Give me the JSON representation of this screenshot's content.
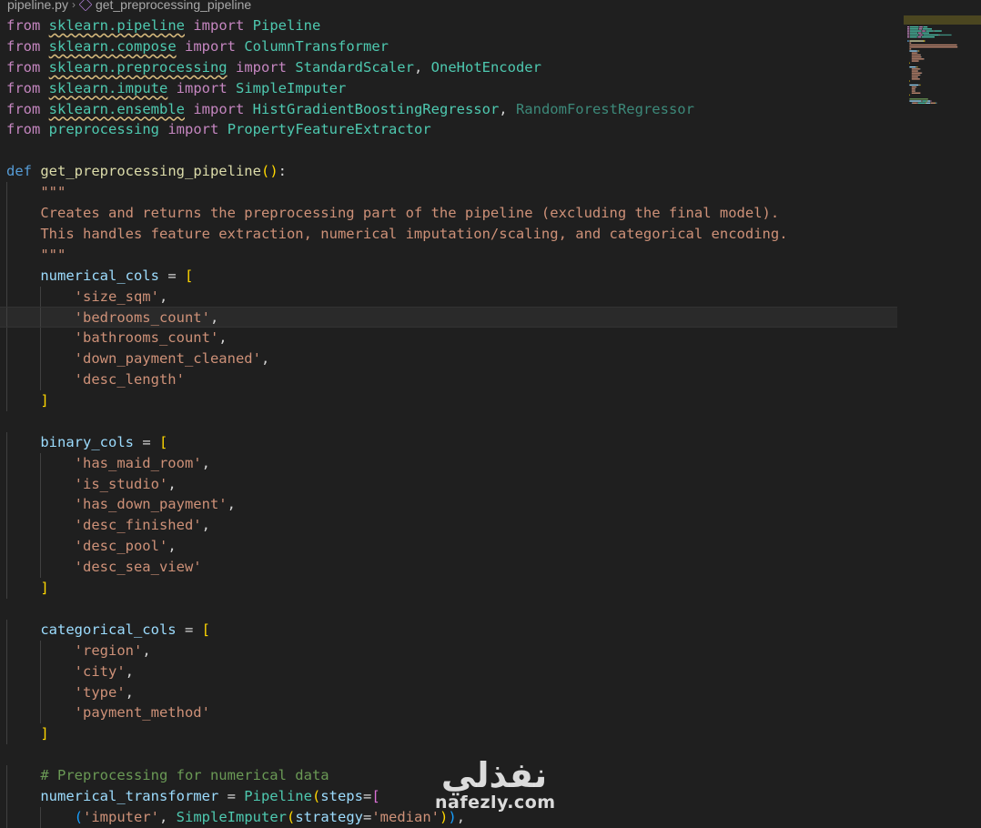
{
  "breadcrumb": {
    "file": "pipeline.py",
    "symbol": "get_preprocessing_pipeline"
  },
  "watermark": {
    "arabic": "نفذلي",
    "latin": "nafezly.com"
  },
  "code": {
    "lines": [
      {
        "tokens": [
          {
            "t": "kw",
            "v": "from"
          },
          {
            "t": "txt",
            "v": " "
          },
          {
            "t": "mod",
            "v": "sklearn.pipeline"
          },
          {
            "t": "txt",
            "v": " "
          },
          {
            "t": "kw",
            "v": "import"
          },
          {
            "t": "txt",
            "v": " "
          },
          {
            "t": "cls",
            "v": "Pipeline"
          }
        ]
      },
      {
        "tokens": [
          {
            "t": "kw",
            "v": "from"
          },
          {
            "t": "txt",
            "v": " "
          },
          {
            "t": "mod",
            "v": "sklearn.compose"
          },
          {
            "t": "txt",
            "v": " "
          },
          {
            "t": "kw",
            "v": "import"
          },
          {
            "t": "txt",
            "v": " "
          },
          {
            "t": "cls",
            "v": "ColumnTransformer"
          }
        ]
      },
      {
        "tokens": [
          {
            "t": "kw",
            "v": "from"
          },
          {
            "t": "txt",
            "v": " "
          },
          {
            "t": "mod",
            "v": "sklearn.preprocessing"
          },
          {
            "t": "txt",
            "v": " "
          },
          {
            "t": "kw",
            "v": "import"
          },
          {
            "t": "txt",
            "v": " "
          },
          {
            "t": "cls",
            "v": "StandardScaler"
          },
          {
            "t": "txt",
            "v": ", "
          },
          {
            "t": "cls",
            "v": "OneHotEncoder"
          }
        ]
      },
      {
        "tokens": [
          {
            "t": "kw",
            "v": "from"
          },
          {
            "t": "txt",
            "v": " "
          },
          {
            "t": "mod",
            "v": "sklearn.impute"
          },
          {
            "t": "txt",
            "v": " "
          },
          {
            "t": "kw",
            "v": "import"
          },
          {
            "t": "txt",
            "v": " "
          },
          {
            "t": "cls",
            "v": "SimpleImputer"
          }
        ]
      },
      {
        "tokens": [
          {
            "t": "kw",
            "v": "from"
          },
          {
            "t": "txt",
            "v": " "
          },
          {
            "t": "mod",
            "v": "sklearn.ensemble"
          },
          {
            "t": "txt",
            "v": " "
          },
          {
            "t": "kw",
            "v": "import"
          },
          {
            "t": "txt",
            "v": " "
          },
          {
            "t": "cls",
            "v": "HistGradientBoostingRegressor"
          },
          {
            "t": "txt",
            "v": ", "
          },
          {
            "t": "dim",
            "v": "RandomForestRegressor"
          }
        ]
      },
      {
        "tokens": [
          {
            "t": "kw",
            "v": "from"
          },
          {
            "t": "txt",
            "v": " "
          },
          {
            "t": "mod2",
            "v": "preprocessing"
          },
          {
            "t": "txt",
            "v": " "
          },
          {
            "t": "kw",
            "v": "import"
          },
          {
            "t": "txt",
            "v": " "
          },
          {
            "t": "cls",
            "v": "PropertyFeatureExtractor"
          }
        ]
      },
      {
        "tokens": []
      },
      {
        "tokens": [
          {
            "t": "def",
            "v": "def"
          },
          {
            "t": "txt",
            "v": " "
          },
          {
            "t": "fn",
            "v": "get_preprocessing_pipeline"
          },
          {
            "t": "br1",
            "v": "()"
          },
          {
            "t": "txt",
            "v": ":"
          }
        ]
      },
      {
        "indent": 1,
        "tokens": [
          {
            "t": "str",
            "v": "\"\"\""
          }
        ]
      },
      {
        "indent": 1,
        "tokens": [
          {
            "t": "str",
            "v": "Creates and returns the preprocessing part of the pipeline (excluding the final model)."
          }
        ]
      },
      {
        "indent": 1,
        "tokens": [
          {
            "t": "str",
            "v": "This handles feature extraction, numerical imputation/scaling, and categorical encoding."
          }
        ]
      },
      {
        "indent": 1,
        "tokens": [
          {
            "t": "str",
            "v": "\"\"\""
          }
        ]
      },
      {
        "indent": 1,
        "tokens": [
          {
            "t": "var",
            "v": "numerical_cols"
          },
          {
            "t": "txt",
            "v": " = "
          },
          {
            "t": "br1",
            "v": "["
          }
        ]
      },
      {
        "indent": 2,
        "tokens": [
          {
            "t": "str",
            "v": "'size_sqm'"
          },
          {
            "t": "txt",
            "v": ","
          }
        ]
      },
      {
        "indent": 2,
        "hl": true,
        "tokens": [
          {
            "t": "str",
            "v": "'bedrooms_count'"
          },
          {
            "t": "txt",
            "v": ","
          }
        ]
      },
      {
        "indent": 2,
        "tokens": [
          {
            "t": "str",
            "v": "'bathrooms_count'"
          },
          {
            "t": "txt",
            "v": ","
          }
        ]
      },
      {
        "indent": 2,
        "tokens": [
          {
            "t": "str",
            "v": "'down_payment_cleaned'"
          },
          {
            "t": "txt",
            "v": ","
          }
        ]
      },
      {
        "indent": 2,
        "tokens": [
          {
            "t": "str",
            "v": "'desc_length'"
          }
        ]
      },
      {
        "indent": 1,
        "tokens": [
          {
            "t": "br1",
            "v": "]"
          }
        ]
      },
      {
        "tokens": []
      },
      {
        "indent": 1,
        "tokens": [
          {
            "t": "var",
            "v": "binary_cols"
          },
          {
            "t": "txt",
            "v": " = "
          },
          {
            "t": "br1",
            "v": "["
          }
        ]
      },
      {
        "indent": 2,
        "tokens": [
          {
            "t": "str",
            "v": "'has_maid_room'"
          },
          {
            "t": "txt",
            "v": ","
          }
        ]
      },
      {
        "indent": 2,
        "tokens": [
          {
            "t": "str",
            "v": "'is_studio'"
          },
          {
            "t": "txt",
            "v": ","
          }
        ]
      },
      {
        "indent": 2,
        "tokens": [
          {
            "t": "str",
            "v": "'has_down_payment'"
          },
          {
            "t": "txt",
            "v": ","
          }
        ]
      },
      {
        "indent": 2,
        "tokens": [
          {
            "t": "str",
            "v": "'desc_finished'"
          },
          {
            "t": "txt",
            "v": ","
          }
        ]
      },
      {
        "indent": 2,
        "tokens": [
          {
            "t": "str",
            "v": "'desc_pool'"
          },
          {
            "t": "txt",
            "v": ","
          }
        ]
      },
      {
        "indent": 2,
        "tokens": [
          {
            "t": "str",
            "v": "'desc_sea_view'"
          }
        ]
      },
      {
        "indent": 1,
        "tokens": [
          {
            "t": "br1",
            "v": "]"
          }
        ]
      },
      {
        "tokens": []
      },
      {
        "indent": 1,
        "tokens": [
          {
            "t": "var",
            "v": "categorical_cols"
          },
          {
            "t": "txt",
            "v": " = "
          },
          {
            "t": "br1",
            "v": "["
          }
        ]
      },
      {
        "indent": 2,
        "tokens": [
          {
            "t": "str",
            "v": "'region'"
          },
          {
            "t": "txt",
            "v": ","
          }
        ]
      },
      {
        "indent": 2,
        "tokens": [
          {
            "t": "str",
            "v": "'city'"
          },
          {
            "t": "txt",
            "v": ","
          }
        ]
      },
      {
        "indent": 2,
        "tokens": [
          {
            "t": "str",
            "v": "'type'"
          },
          {
            "t": "txt",
            "v": ","
          }
        ]
      },
      {
        "indent": 2,
        "tokens": [
          {
            "t": "str",
            "v": "'payment_method'"
          }
        ]
      },
      {
        "indent": 1,
        "tokens": [
          {
            "t": "br1",
            "v": "]"
          }
        ]
      },
      {
        "tokens": []
      },
      {
        "indent": 1,
        "tokens": [
          {
            "t": "com",
            "v": "# Preprocessing for numerical data"
          }
        ]
      },
      {
        "indent": 1,
        "tokens": [
          {
            "t": "var",
            "v": "numerical_transformer"
          },
          {
            "t": "txt",
            "v": " = "
          },
          {
            "t": "cls",
            "v": "Pipeline"
          },
          {
            "t": "br1",
            "v": "("
          },
          {
            "t": "var",
            "v": "steps"
          },
          {
            "t": "txt",
            "v": "="
          },
          {
            "t": "br2",
            "v": "["
          }
        ]
      },
      {
        "indent": 2,
        "tokens": [
          {
            "t": "br3",
            "v": "("
          },
          {
            "t": "str",
            "v": "'imputer'"
          },
          {
            "t": "txt",
            "v": ", "
          },
          {
            "t": "cls",
            "v": "SimpleImputer"
          },
          {
            "t": "br1",
            "v": "("
          },
          {
            "t": "var",
            "v": "strategy"
          },
          {
            "t": "txt",
            "v": "="
          },
          {
            "t": "str",
            "v": "'median'"
          },
          {
            "t": "br1",
            "v": ")"
          },
          {
            "t": "br3",
            "v": ")"
          },
          {
            "t": "txt",
            "v": ","
          }
        ]
      }
    ]
  }
}
